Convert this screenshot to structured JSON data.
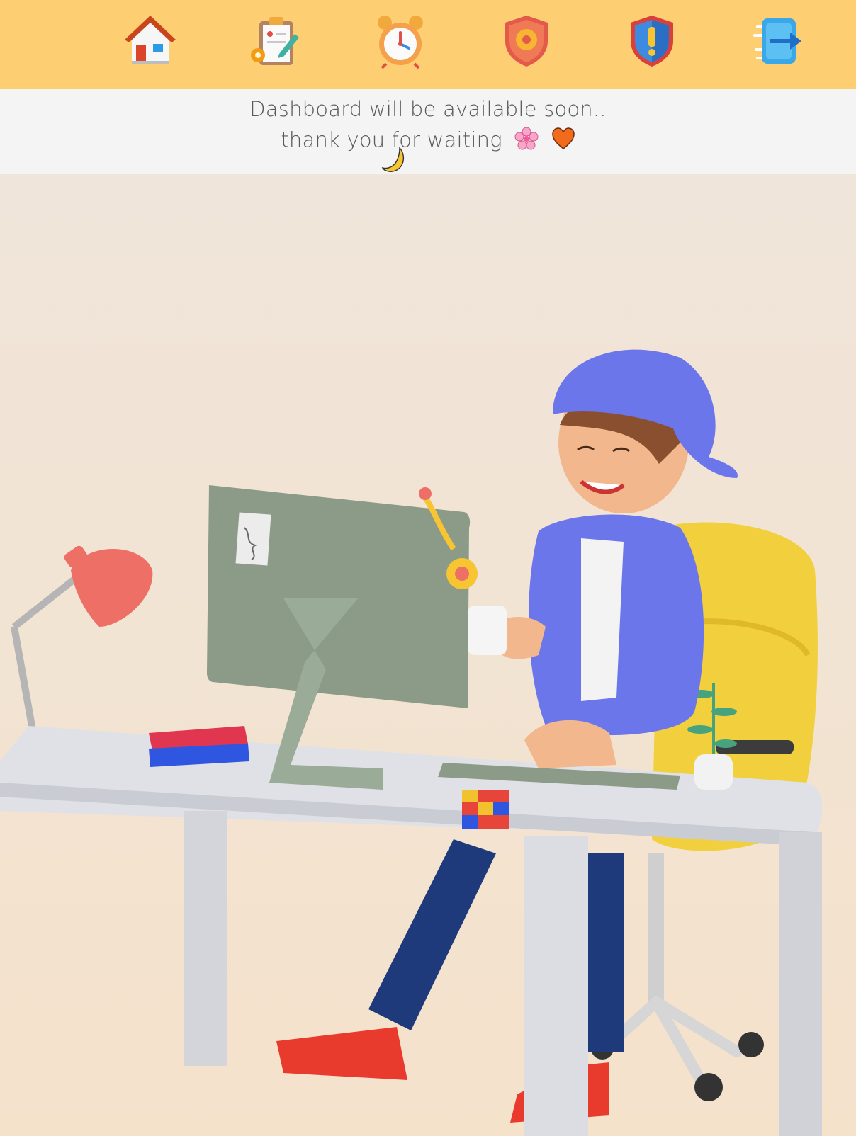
{
  "nav": {
    "items": [
      {
        "name": "home",
        "icon": "house-icon"
      },
      {
        "name": "tasks",
        "icon": "clipboard-gear-icon"
      },
      {
        "name": "reminders",
        "icon": "alarm-clock-icon"
      },
      {
        "name": "security-settings",
        "icon": "shield-gear-icon"
      },
      {
        "name": "alerts",
        "icon": "shield-exclamation-icon"
      },
      {
        "name": "logout",
        "icon": "exit-arrow-icon"
      }
    ],
    "background": "#fece73"
  },
  "notice": {
    "line1": "Dashboard will be available soon..",
    "line2": "thank you for waiting",
    "emojis": [
      "cherry-blossom-icon",
      "orange-heart-icon",
      "crescent-moon-icon"
    ]
  },
  "illustration": {
    "subject": "person-working-at-desk-illustration"
  },
  "colors": {
    "accent": "#fece73",
    "notice_bg": "#f4f4f4",
    "scene_bg": "#f3eadf"
  }
}
